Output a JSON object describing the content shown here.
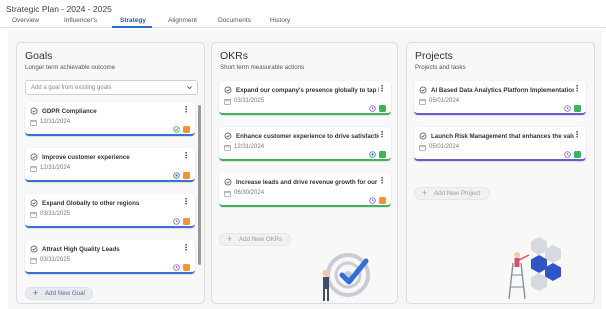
{
  "app": {
    "title": "Strategic Plan - 2024 - 2025"
  },
  "tabs": [
    {
      "label": "Overview"
    },
    {
      "label": "Influencer's"
    },
    {
      "label": "Strategy"
    },
    {
      "label": "Alignment"
    },
    {
      "label": "Documents"
    },
    {
      "label": "History"
    }
  ],
  "goals": {
    "title": "Goals",
    "subtitle": "Longer term achievable outcome",
    "select_placeholder": "Add a goal from existing goals",
    "add_label": "Add New Goal",
    "cards": [
      {
        "title": "GDPR Compliance",
        "date": "12/31/2024",
        "icon1": "check-circle-icon",
        "icon2": "orange-square-icon"
      },
      {
        "title": "Improve customer experience",
        "date": "12/31/2024",
        "icon1": "target-icon",
        "icon2": "orange-square-icon"
      },
      {
        "title": "Expand Globally to other regions",
        "date": "03/31/2025",
        "icon1": "clock-icon",
        "icon2": "orange-square-icon"
      },
      {
        "title": "Attract High Quality Leads",
        "date": "03/31/2025",
        "icon1": "clock-icon",
        "icon2": "orange-square-icon"
      }
    ]
  },
  "okrs": {
    "title": "OKRs",
    "subtitle": "Short term measurable actions",
    "add_label": "Add New OKRs",
    "cards": [
      {
        "title": "Expand our company's presence globally to tap int...",
        "date": "03/31/2025",
        "icon1": "clock-icon",
        "icon2": "green-square-icon"
      },
      {
        "title": "Enhance customer experience to drive satisfaction ...",
        "date": "12/31/2024",
        "icon1": "target-icon",
        "icon2": "green-square-icon"
      },
      {
        "title": "Increase leads and drive revenue growth for our S...",
        "date": "06/30/2024",
        "icon1": "clock-icon",
        "icon2": "orange-square-icon"
      }
    ]
  },
  "projects": {
    "title": "Projects",
    "subtitle": "Projects and tasks",
    "add_label": "Add New Project",
    "cards": [
      {
        "title": "AI Based Data Analytics Platform Implementation",
        "date": "05/01/2024",
        "icon1": "clock-icon",
        "icon2": "green-square-icon"
      },
      {
        "title": "Launch Risk Management that enhances the value ...",
        "date": "05/01/2024",
        "icon1": "clock-icon",
        "icon2": "green-square-icon"
      }
    ]
  },
  "colors": {
    "accent": "#2a6fce",
    "goal_bar": "#3b6fd6",
    "okr_bar": "#3db35c",
    "project_bar": "#6a5acd",
    "orange": "#f0963a",
    "green": "#3db35c",
    "purple": "#7c5cc4"
  }
}
